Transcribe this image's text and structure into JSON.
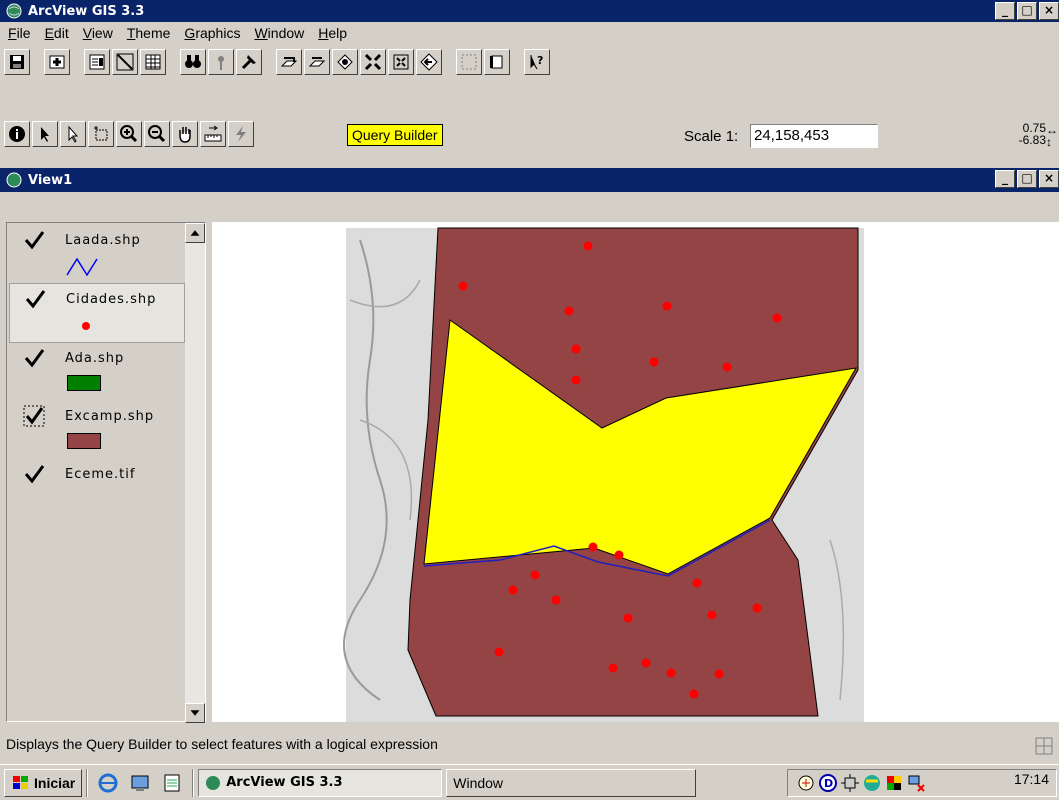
{
  "app": {
    "title": "ArcView GIS 3.3",
    "menu": [
      {
        "label": "File",
        "accel": "F",
        "rest": "ile"
      },
      {
        "label": "Edit",
        "accel": "E",
        "rest": "dit"
      },
      {
        "label": "View",
        "accel": "V",
        "rest": "iew"
      },
      {
        "label": "Theme",
        "accel": "T",
        "rest": "heme"
      },
      {
        "label": "Graphics",
        "accel": "G",
        "rest": "raphics"
      },
      {
        "label": "Window",
        "accel": "W",
        "rest": "indow"
      },
      {
        "label": "Help",
        "accel": "H",
        "rest": "elp"
      }
    ]
  },
  "toolbar": {
    "tooltip": "Query Builder",
    "scale_label": "Scale 1:",
    "scale_value": "24,158,453",
    "coord_x": "0.75",
    "coord_y": "-6.83"
  },
  "view": {
    "title": "View1",
    "layers": [
      {
        "name": "Laada.shp",
        "checked": true,
        "legend": "line",
        "color": "#0000ff"
      },
      {
        "name": "Cidades.shp",
        "checked": true,
        "legend": "point",
        "color": "#ff0000"
      },
      {
        "name": "Ada.shp",
        "checked": true,
        "legend": "box",
        "color": "#007f00"
      },
      {
        "name": "Excamp.shp",
        "checked": true,
        "legend": "box",
        "color": "#944444"
      },
      {
        "name": "Eceme.tif",
        "checked": true,
        "legend": "none",
        "color": ""
      }
    ]
  },
  "status": {
    "message": "Displays the Query Builder to select features with a logical expression"
  },
  "taskbar": {
    "start_label": "Iniciar",
    "tasks": [
      "ArcView GIS 3.3",
      "Window"
    ],
    "clock": "17:14"
  },
  "colors": {
    "titlebar": "#0a246a",
    "polygon_brown": "#944444",
    "polygon_yellow": "#ffff00",
    "cities": "#ff0000"
  }
}
